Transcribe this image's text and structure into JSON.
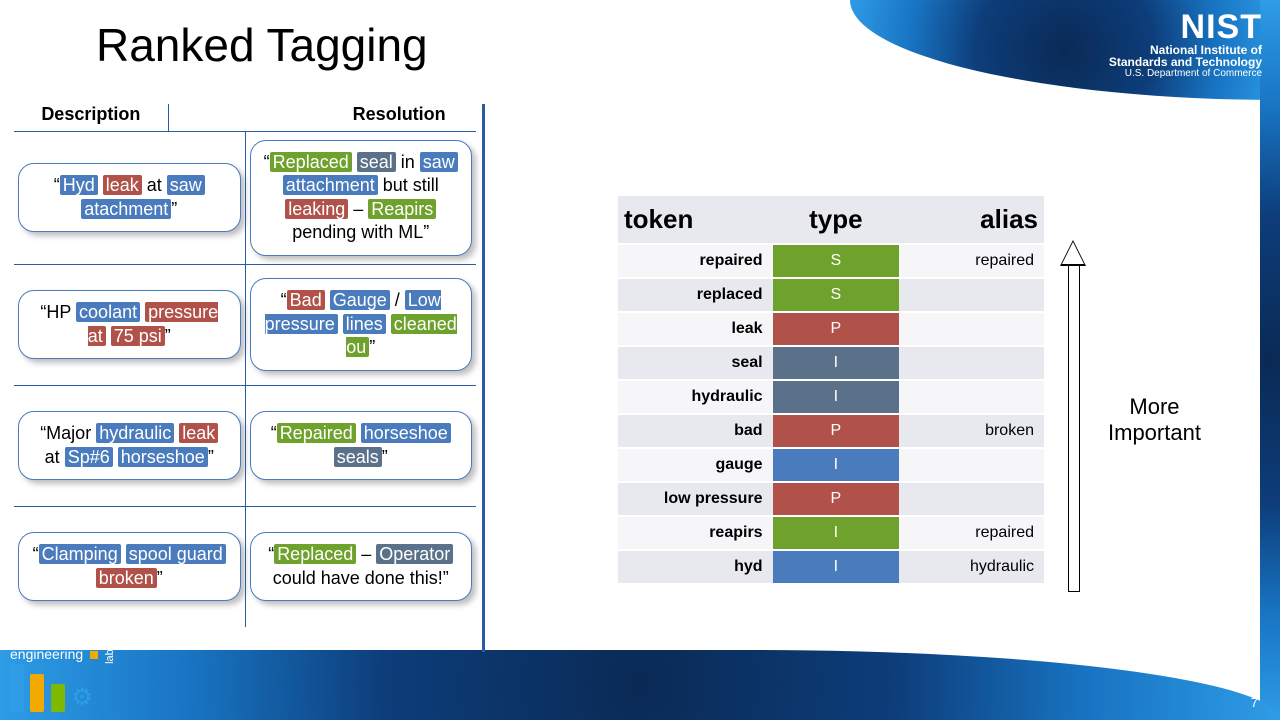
{
  "page": {
    "title": "Ranked Tagging",
    "number": "7"
  },
  "logo": {
    "name": "NIST",
    "line1": "National Institute of",
    "line2": "Standards and Technology",
    "line3": "U.S. Department of Commerce"
  },
  "footer_label": {
    "word1": "engineering",
    "word2": "laboratory"
  },
  "columns": {
    "left_header_a": "Description",
    "left_header_b": "Resolution"
  },
  "examples": [
    {
      "desc": [
        {
          "t": "“"
        },
        {
          "t": "Hyd",
          "c": "blue"
        },
        {
          "t": " "
        },
        {
          "t": "leak",
          "c": "red"
        },
        {
          "t": " at "
        },
        {
          "t": "saw",
          "c": "blue"
        },
        {
          "t": " "
        },
        {
          "t": "atachment",
          "c": "blue"
        },
        {
          "t": "”"
        }
      ],
      "res": [
        {
          "t": "“"
        },
        {
          "t": "Replaced",
          "c": "green"
        },
        {
          "t": " "
        },
        {
          "t": "seal",
          "c": "darkb"
        },
        {
          "t": " in "
        },
        {
          "t": "saw",
          "c": "blue"
        },
        {
          "t": " "
        },
        {
          "t": "attachment",
          "c": "blue"
        },
        {
          "t": " but still "
        },
        {
          "t": "leaking",
          "c": "red"
        },
        {
          "t": " – "
        },
        {
          "t": "Reapirs",
          "c": "green"
        },
        {
          "t": " pending with ML”"
        }
      ]
    },
    {
      "desc": [
        {
          "t": "“HP "
        },
        {
          "t": "coolant",
          "c": "blue"
        },
        {
          "t": " "
        },
        {
          "t": "pressure  at",
          "c": "red"
        },
        {
          "t": " "
        },
        {
          "t": "75 psi",
          "c": "red"
        },
        {
          "t": "”"
        }
      ],
      "res": [
        {
          "t": "“"
        },
        {
          "t": "Bad",
          "c": "red"
        },
        {
          "t": " "
        },
        {
          "t": "Gauge",
          "c": "blue"
        },
        {
          "t": " / "
        },
        {
          "t": "Low pressure",
          "c": "blue"
        },
        {
          "t": " "
        },
        {
          "t": "lines",
          "c": "blue"
        },
        {
          "t": " "
        },
        {
          "t": "cleaned ou",
          "c": "green"
        },
        {
          "t": "”"
        }
      ]
    },
    {
      "desc": [
        {
          "t": "“Major "
        },
        {
          "t": "hydraulic",
          "c": "blue"
        },
        {
          "t": " "
        },
        {
          "t": "leak",
          "c": "red"
        },
        {
          "t": " at "
        },
        {
          "t": "Sp#6",
          "c": "blue"
        },
        {
          "t": " "
        },
        {
          "t": "horseshoe",
          "c": "blue"
        },
        {
          "t": "”"
        }
      ],
      "res": [
        {
          "t": "“"
        },
        {
          "t": "Repaired",
          "c": "green"
        },
        {
          "t": " "
        },
        {
          "t": "horseshoe",
          "c": "blue"
        },
        {
          "t": " "
        },
        {
          "t": "seals",
          "c": "darkb"
        },
        {
          "t": "”"
        }
      ]
    },
    {
      "desc": [
        {
          "t": "“"
        },
        {
          "t": "Clamping",
          "c": "blue"
        },
        {
          "t": " "
        },
        {
          "t": "spool guard",
          "c": "blue"
        },
        {
          "t": " "
        },
        {
          "t": "broken",
          "c": "red"
        },
        {
          "t": "”"
        }
      ],
      "res": [
        {
          "t": "“"
        },
        {
          "t": "Replaced",
          "c": "green"
        },
        {
          "t": " – "
        },
        {
          "t": "Operator",
          "c": "darkb"
        },
        {
          "t": " could have done this!”"
        }
      ]
    }
  ],
  "token_table": {
    "headers": {
      "token": "token",
      "type": "type",
      "alias": "alias"
    },
    "rows": [
      {
        "token": "repaired",
        "type": "S",
        "type_class": "type-S",
        "alias": "repaired"
      },
      {
        "token": "replaced",
        "type": "S",
        "type_class": "type-S",
        "alias": ""
      },
      {
        "token": "leak",
        "type": "P",
        "type_class": "type-P",
        "alias": ""
      },
      {
        "token": "seal",
        "type": "I",
        "type_class": "type-Idark",
        "alias": ""
      },
      {
        "token": "hydraulic",
        "type": "I",
        "type_class": "type-Idark",
        "alias": ""
      },
      {
        "token": "bad",
        "type": "P",
        "type_class": "type-P",
        "alias": "broken"
      },
      {
        "token": "gauge",
        "type": "I",
        "type_class": "type-Iblue",
        "alias": ""
      },
      {
        "token": "low pressure",
        "type": "P",
        "type_class": "type-P",
        "alias": ""
      },
      {
        "token": "reapirs",
        "type": "I",
        "type_class": "type-Igreen",
        "alias": "repaired"
      },
      {
        "token": "hyd",
        "type": "I",
        "type_class": "type-Iblue",
        "alias": "hydraulic"
      }
    ]
  },
  "annotation": {
    "line1": "More",
    "line2": "Important"
  },
  "colors": {
    "blue": "#4a7bbc",
    "darkb": "#5a7189",
    "red": "#b1524a",
    "green": "#6fa22c",
    "accent": "#2a5ca5"
  }
}
